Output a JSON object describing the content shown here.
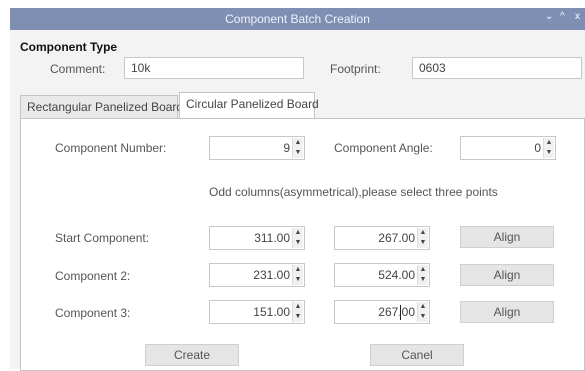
{
  "window": {
    "title": "Component Batch Creation",
    "controls": [
      "⌄",
      "^",
      "x"
    ]
  },
  "header": {
    "section_title": "Component Type",
    "comment_label": "Comment:",
    "comment_value": "10k",
    "footprint_label": "Footprint:",
    "footprint_value": "0603"
  },
  "tabs": [
    {
      "label": "Rectangular Panelized Board",
      "active": false
    },
    {
      "label": "Circular Panelized Board",
      "active": true
    }
  ],
  "panel": {
    "component_number_label": "Component Number:",
    "component_number_value": "9",
    "component_angle_label": "Component Angle:",
    "component_angle_value": "0",
    "hint": "Odd columns(asymmetrical),please select three points",
    "rows": [
      {
        "label": "Start Component:",
        "x": "311.00",
        "y": "267.00",
        "button": "Align"
      },
      {
        "label": "Component 2:",
        "x": "231.00",
        "y": "524.00",
        "button": "Align"
      },
      {
        "label": "Component 3:",
        "x": "151.00",
        "y": "267.00",
        "button": "Align"
      }
    ]
  },
  "footer": {
    "create_label": "Create",
    "cancel_label": "Canel"
  }
}
